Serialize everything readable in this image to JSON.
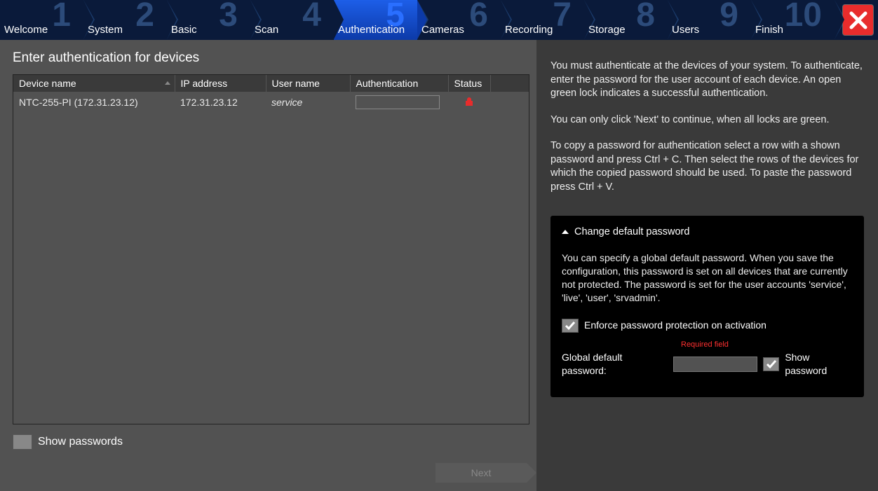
{
  "wizard": {
    "steps": [
      {
        "num": "1",
        "label": "Welcome"
      },
      {
        "num": "2",
        "label": "System"
      },
      {
        "num": "3",
        "label": "Basic"
      },
      {
        "num": "4",
        "label": "Scan"
      },
      {
        "num": "5",
        "label": "Authentication"
      },
      {
        "num": "6",
        "label": "Cameras"
      },
      {
        "num": "7",
        "label": "Recording"
      },
      {
        "num": "8",
        "label": "Storage"
      },
      {
        "num": "9",
        "label": "Users"
      },
      {
        "num": "10",
        "label": "Finish"
      }
    ],
    "active_index": 4
  },
  "page_title": "Enter authentication for devices",
  "table": {
    "headers": {
      "device": "Device name",
      "ip": "IP address",
      "user": "User name",
      "auth": "Authentication",
      "status": "Status"
    },
    "rows": [
      {
        "device": "NTC-255-PI (172.31.23.12)",
        "ip": "172.31.23.12",
        "user": "service",
        "auth": "",
        "status": "locked"
      }
    ]
  },
  "show_passwords_label": "Show passwords",
  "next_label": "Next",
  "help": {
    "p1": "You must authenticate at the devices of your system. To authenticate, enter the password for the user account of each device. An open green lock indicates a successful authentication.",
    "p2": "You can only click 'Next' to continue, when all locks are green.",
    "p3": "To copy a password for authentication select a row with a shown password and press Ctrl + C. Then select the rows of the devices for which the copied password should be used. To paste the password press Ctrl + V."
  },
  "panel": {
    "title": "Change default password",
    "body": "You can specify a global default password. When you save the configuration, this password is set on all devices that are currently not protected. The password is set for the user accounts 'service', 'live', 'user', 'srvadmin'.",
    "enforce_label": "Enforce password protection on activation",
    "required_label": "Required field",
    "global_pw_label": "Global default password:",
    "show_pw_label": "Show password"
  }
}
